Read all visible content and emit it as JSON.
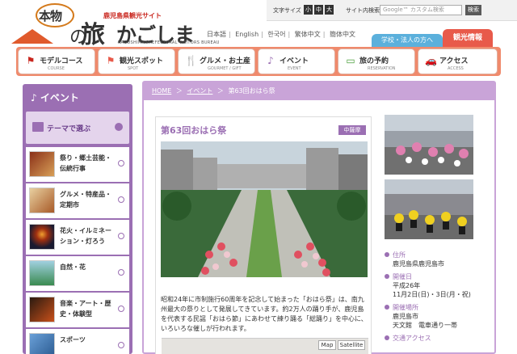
{
  "header": {
    "logo_hon": "本物",
    "logo_no": "の",
    "logo_tabi": "旅",
    "logo_kagoshima": "かごしま",
    "logo_sub": "鹿児島県観光サイト",
    "logo_en": "KAGOSHIMA PREFECTURAL VISITORS BUREAU",
    "fontsize_label": "文字サイズ",
    "fontsize_small": "小",
    "fontsize_medium": "中",
    "fontsize_large": "大",
    "search_label": "サイト内検索",
    "search_placeholder": "Google™ カスタム検索",
    "search_button": "検索",
    "languages": [
      "日本語",
      "English",
      "한국어",
      "繁体中文",
      "簡体中文"
    ],
    "school_button": "学校・法人の方へ",
    "kanko_button": "観光情報"
  },
  "nav": [
    {
      "label": "モデルコース",
      "en": "COURSE",
      "icon": "flag-icon",
      "color": "#c9261e"
    },
    {
      "label": "観光スポット",
      "en": "SPOT",
      "icon": "flag-icon",
      "color": "#e85a4a"
    },
    {
      "label": "グルメ・お土産",
      "en": "GOURMET / GIFT",
      "icon": "food-icon",
      "color": "#e0a020"
    },
    {
      "label": "イベント",
      "en": "EVENT",
      "icon": "music-note-icon",
      "color": "#9b6fb3"
    },
    {
      "label": "旅の予約",
      "en": "RESERVATION",
      "icon": "monitor-icon",
      "color": "#4a9e3a"
    },
    {
      "label": "アクセス",
      "en": "ACCESS",
      "icon": "car-icon",
      "color": "#3d7fc4"
    }
  ],
  "sidebar": {
    "title": "イベント",
    "sub_label": "テーマで選ぶ",
    "items": [
      {
        "text": "祭り・郷土芸能・伝統行事",
        "thumb_color": "#b8502a"
      },
      {
        "text": "グルメ・特産品・定期市",
        "thumb_color": "#d8b070"
      },
      {
        "text": "花火・イルミネーション・灯ろう",
        "thumb_color": "#2a2a4a"
      },
      {
        "text": "自然・花",
        "thumb_color": "#5ab070"
      },
      {
        "text": "音楽・アート・歴史・体験型",
        "thumb_color": "#4a3020"
      },
      {
        "text": "スポーツ",
        "thumb_color": "#4a7ab0"
      }
    ]
  },
  "breadcrumb": {
    "home": "HOME",
    "sep": "＞",
    "event": "イベント",
    "current": "第63回おはら祭"
  },
  "event": {
    "title": "第63回おはら祭",
    "region": "中薩摩",
    "description": "昭和24年に市制施行60周年を記念して始まった「おはら祭」は、南九州最大の祭りとして発展してきています。約2万人の踊り手が、鹿児島を代表する民謡「おはら節」にあわせて練り踊る「総踊り」を中心に、いろいろな催しが行われます。",
    "map_btn_map": "Map",
    "map_btn_satellite": "Satellite"
  },
  "info": [
    {
      "label": "住所",
      "value": "鹿児島県鹿児島市"
    },
    {
      "label": "開催日",
      "value": "平成26年\n11月2日(日)・3日(月・祝)"
    },
    {
      "label": "開催場所",
      "value": "鹿児島市\n天文館　電車通り一帯"
    },
    {
      "label": "交通アクセス",
      "value": ""
    }
  ]
}
